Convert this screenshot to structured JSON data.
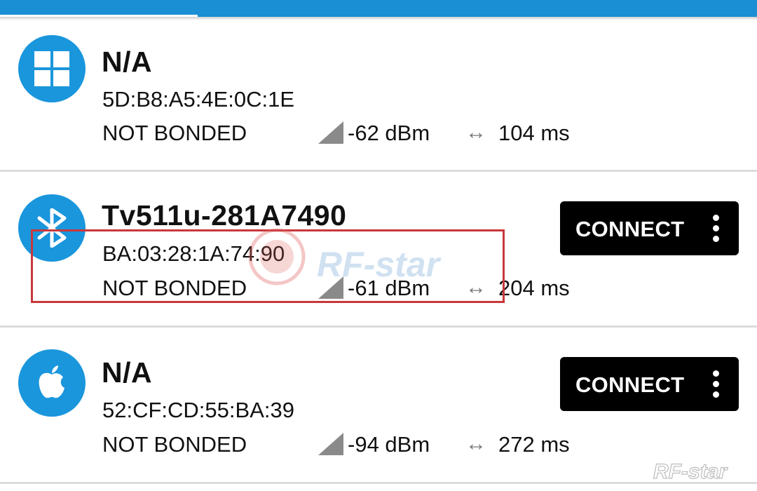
{
  "devices": [
    {
      "name": "N/A",
      "mac": "5D:B8:A5:4E:0C:1E",
      "bond_state": "NOT BONDED",
      "rssi": "-62 dBm",
      "interval": "104 ms",
      "icon": "windows-icon",
      "connect_label": null
    },
    {
      "name": "Tv511u-281A7490",
      "mac": "BA:03:28:1A:74:90",
      "bond_state": "NOT BONDED",
      "rssi": "-61 dBm",
      "interval": "204 ms",
      "icon": "bluetooth-icon",
      "connect_label": "CONNECT"
    },
    {
      "name": "N/A",
      "mac": "52:CF:CD:55:BA:39",
      "bond_state": "NOT BONDED",
      "rssi": "-94 dBm",
      "interval": "272 ms",
      "icon": "apple-icon",
      "connect_label": "CONNECT"
    }
  ],
  "interval_symbol": "↔",
  "watermark": "RF-star",
  "colors": {
    "accent": "#1a8fd3",
    "avatar": "#1a96dc",
    "highlight": "#c8373b",
    "button": "#000000"
  }
}
